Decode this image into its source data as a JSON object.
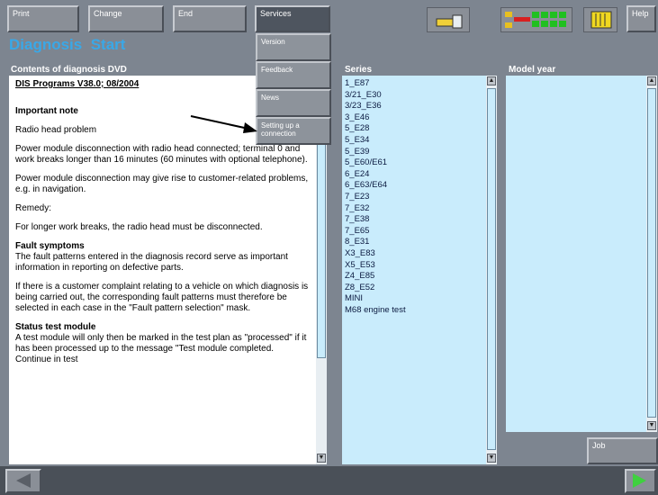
{
  "toolbar": {
    "print_label": "Print",
    "change_label": "Change",
    "end_label": "End",
    "services_label": "Services",
    "help_label": "Help"
  },
  "services_menu": {
    "items": [
      "Version",
      "Feedback",
      "News",
      "Setting up a connection"
    ]
  },
  "header": {
    "diagnosis": "Diagnosis",
    "start": "Start"
  },
  "contents": {
    "heading": "Contents of diagnosis DVD",
    "program": "DIS Programs V38.0; 08/2004",
    "important_note": "Important note",
    "radio_problem": "Radio head problem",
    "para1": "Power module disconnection with radio head connected; terminal 0 and work breaks longer than 16 minutes (60 minutes with optional telephone).",
    "para2": "Power module disconnection may give rise to customer-related problems, e.g. in navigation.",
    "remedy": "Remedy:",
    "para3": "For longer work breaks, the radio head must be disconnected.",
    "fault_title": "Fault symptoms",
    "para4": "The fault patterns entered in the diagnosis record serve as important information in reporting on defective parts.",
    "para5": "If there is a customer complaint relating to a vehicle on which diagnosis is being carried out, the corresponding fault patterns must therefore be selected in each case in the \"Fault pattern selection\" mask.",
    "status_title": "Status test module",
    "para6": "A test module will only then be marked in the test plan as \"processed\" if it has been processed up to the message \"Test module completed. Continue in test"
  },
  "series": {
    "heading": "Series",
    "items": [
      "1_E87",
      "3/21_E30",
      "3/23_E36",
      "3_E46",
      "5_E28",
      "5_E34",
      "5_E39",
      "5_E60/E61",
      "6_E24",
      "6_E63/E64",
      "7_E23",
      "7_E32",
      "7_E38",
      "7_E65",
      "8_E31",
      "X3_E83",
      "X5_E53",
      "Z4_E85",
      "Z8_E52",
      "MINI",
      "M68 engine test"
    ]
  },
  "model_year": {
    "heading": "Model year"
  },
  "job_label": "Job",
  "scroll": {
    "up": "▲",
    "down": "▼"
  },
  "colors": {
    "background": "#7d8590",
    "title": "#39a8e8",
    "list_bg": "#c9ecfc",
    "nav_arrow": "#3fd13f"
  },
  "icons": {
    "status_connector": "connector-icon",
    "status_battery": "battery-status-icon",
    "status_module": "module-icon",
    "arrow_left": "left-arrow-icon",
    "arrow_right": "right-arrow-icon"
  }
}
